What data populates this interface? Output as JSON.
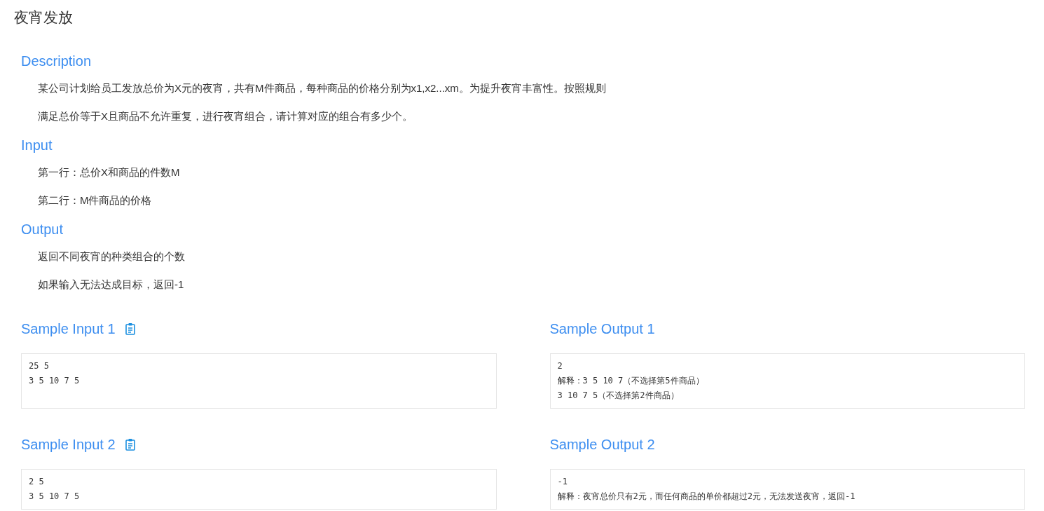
{
  "title": "夜宵发放",
  "sections": [
    {
      "heading": "Description",
      "paragraphs": [
        "某公司计划给员工发放总价为X元的夜宵，共有M件商品，每种商品的价格分别为x1,x2...xm。为提升夜宵丰富性。按照规则",
        "满足总价等于X且商品不允许重复，进行夜宵组合，请计算对应的组合有多少个。"
      ]
    },
    {
      "heading": "Input",
      "paragraphs": [
        "第一行：总价X和商品的件数M",
        "第二行：M件商品的价格"
      ]
    },
    {
      "heading": "Output",
      "paragraphs": [
        "返回不同夜宵的种类组合的个数",
        "如果输入无法达成目标，返回-1"
      ]
    }
  ],
  "samples": [
    {
      "input": {
        "heading": "Sample Input 1",
        "lines": [
          "25 5",
          "3 5 10 7 5"
        ]
      },
      "output": {
        "heading": "Sample Output 1",
        "lines": [
          "2",
          "解释：3 5 10 7（不选择第5件商品）",
          "3 10 7 5（不选择第2件商品）"
        ]
      }
    },
    {
      "input": {
        "heading": "Sample Input 2",
        "lines": [
          "2 5",
          "3 5 10 7 5"
        ]
      },
      "output": {
        "heading": "Sample Output 2",
        "lines": [
          "-1",
          "解释：夜宵总价只有2元，而任何商品的单价都超过2元，无法发送夜宵，返回-1"
        ]
      }
    }
  ]
}
